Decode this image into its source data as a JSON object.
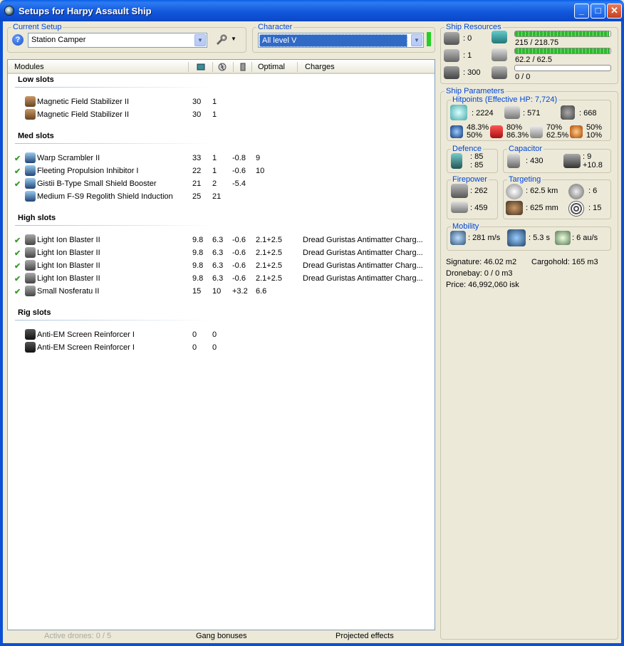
{
  "window": {
    "title": "Setups for Harpy Assault Ship"
  },
  "current_setup": {
    "label": "Current Setup",
    "value": "Station Camper"
  },
  "character": {
    "label": "Character",
    "value": "All level V"
  },
  "modules_header": {
    "name": "Modules",
    "optimal": "Optimal",
    "charges": "Charges"
  },
  "low_slots": {
    "title": "Low slots",
    "items": [
      {
        "name": "Magnetic Field Stabilizer II",
        "cpu": "30",
        "pg": "1",
        "cap": "",
        "optimal": "",
        "charges": "",
        "active": false
      },
      {
        "name": "Magnetic Field Stabilizer II",
        "cpu": "30",
        "pg": "1",
        "cap": "",
        "optimal": "",
        "charges": "",
        "active": false
      }
    ]
  },
  "med_slots": {
    "title": "Med slots",
    "items": [
      {
        "name": "Warp Scrambler II",
        "cpu": "33",
        "pg": "1",
        "cap": "-0.8",
        "optimal": "9",
        "charges": "",
        "active": true
      },
      {
        "name": "Fleeting Propulsion Inhibitor I",
        "cpu": "22",
        "pg": "1",
        "cap": "-0.6",
        "optimal": "10",
        "charges": "",
        "active": true
      },
      {
        "name": "Gistii B-Type Small Shield Booster",
        "cpu": "21",
        "pg": "2",
        "cap": "-5.4",
        "optimal": "",
        "charges": "",
        "active": true
      },
      {
        "name": "Medium F-S9 Regolith Shield Induction",
        "cpu": "25",
        "pg": "21",
        "cap": "",
        "optimal": "",
        "charges": "",
        "active": false
      }
    ]
  },
  "high_slots": {
    "title": "High slots",
    "items": [
      {
        "name": "Light Ion Blaster II",
        "cpu": "9.8",
        "pg": "6.3",
        "cap": "-0.6",
        "optimal": "2.1+2.5",
        "charges": "Dread Guristas Antimatter Charg...",
        "active": true
      },
      {
        "name": "Light Ion Blaster II",
        "cpu": "9.8",
        "pg": "6.3",
        "cap": "-0.6",
        "optimal": "2.1+2.5",
        "charges": "Dread Guristas Antimatter Charg...",
        "active": true
      },
      {
        "name": "Light Ion Blaster II",
        "cpu": "9.8",
        "pg": "6.3",
        "cap": "-0.6",
        "optimal": "2.1+2.5",
        "charges": "Dread Guristas Antimatter Charg...",
        "active": true
      },
      {
        "name": "Light Ion Blaster II",
        "cpu": "9.8",
        "pg": "6.3",
        "cap": "-0.6",
        "optimal": "2.1+2.5",
        "charges": "Dread Guristas Antimatter Charg...",
        "active": true
      },
      {
        "name": "Small Nosferatu II",
        "cpu": "15",
        "pg": "10",
        "cap": "+3.2",
        "optimal": "6.6",
        "charges": "",
        "active": true
      }
    ]
  },
  "rig_slots": {
    "title": "Rig slots",
    "items": [
      {
        "name": "Anti-EM Screen Reinforcer I",
        "cpu": "0",
        "pg": "0",
        "cap": "",
        "optimal": "",
        "charges": "",
        "active": false
      },
      {
        "name": "Anti-EM Screen Reinforcer I",
        "cpu": "0",
        "pg": "0",
        "cap": "",
        "optimal": "",
        "charges": "",
        "active": false
      }
    ]
  },
  "ship_resources": {
    "label": "Ship Resources",
    "turrets": ": 0",
    "launchers": ": 1",
    "calibration": ": 300",
    "cpu": "215 / 218.75",
    "powergrid": "62.2 / 62.5",
    "drone_bandwidth": "0 / 0",
    "cpu_fraction": 0.983,
    "pg_fraction": 0.995,
    "drone_fraction": 0
  },
  "ship_parameters": {
    "label": "Ship Parameters",
    "hitpoints": {
      "label": "Hitpoints (Effective HP: 7,724)",
      "shield": ": 2224",
      "armor": ": 571",
      "structure": ": 668",
      "em": "48.3%",
      "em2": "50%",
      "thermal": "80%",
      "thermal2": "86.3%",
      "kinetic": "70%",
      "kinetic2": "62.5%",
      "explosive": "50%",
      "explosive2": "10%"
    },
    "defence": {
      "label": "Defence",
      "v1": ": 85",
      "v2": ": 85"
    },
    "capacitor": {
      "label": "Capacitor",
      "capacity": ": 430",
      "v1": ": 9",
      "v2": "+10.8"
    },
    "firepower": {
      "label": "Firepower",
      "turret": ": 262",
      "volley": ": 459"
    },
    "targeting": {
      "label": "Targeting",
      "range": ": 62.5 km",
      "targets": ": 6",
      "scan_res": ": 625 mm",
      "sensor": ": 15"
    },
    "mobility": {
      "label": "Mobility",
      "speed": ": 281 m/s",
      "align": ": 5.3 s",
      "warp": ": 6 au/s"
    },
    "signature": "Signature: 46.02 m2",
    "cargohold": "Cargohold: 165 m3",
    "dronebay": "Dronebay: 0 / 0 m3",
    "price": "Price: 46,992,060 isk"
  },
  "bottom": {
    "active_drones": "Active drones: 0 / 5",
    "gang": "Gang bonuses",
    "projected": "Projected effects"
  },
  "colors": {
    "accent": "#0046d5",
    "titlebar": "#0a5ee8",
    "check": "#3a9e2a",
    "bar_fill": "#2fb82f"
  }
}
